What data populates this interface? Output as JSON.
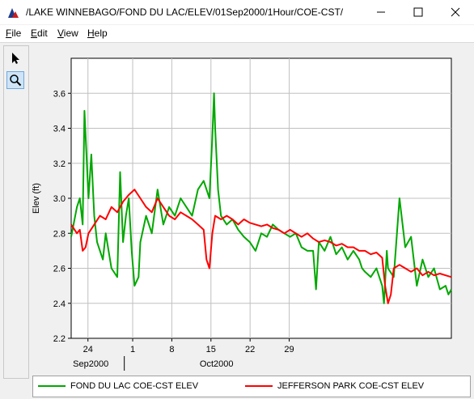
{
  "window": {
    "title": "/LAKE WINNEBAGO/FOND DU LAC/ELEV/01Sep2000/1Hour/COE-CST/"
  },
  "menu": {
    "items": [
      {
        "key": "F",
        "rest": "ile"
      },
      {
        "key": "E",
        "rest": "dit"
      },
      {
        "key": "V",
        "rest": "iew"
      },
      {
        "key": "H",
        "rest": "elp"
      }
    ]
  },
  "toolbar": {
    "tools": [
      {
        "name": "pointer",
        "icon": "arrow-pointer-icon"
      },
      {
        "name": "zoom",
        "icon": "magnifier-icon"
      }
    ]
  },
  "colors": {
    "series1": "#00a800",
    "series2": "#ff0000",
    "grid": "#c0c0c0"
  },
  "chart_data": {
    "type": "line",
    "title": "",
    "ylabel": "Elev (ft)",
    "xlabel": "",
    "ylim": [
      2.2,
      3.8
    ],
    "yticks": [
      "2.2",
      "2.4",
      "2.6",
      "2.8",
      "3.0",
      "3.2",
      "3.4",
      "3.6"
    ],
    "xticks": [
      "24",
      "1",
      "8",
      "15",
      "22",
      "29"
    ],
    "xmonths": [
      "Sep2000",
      "Oct2000"
    ],
    "grid": true,
    "legend_position": "bottom",
    "series": [
      {
        "name": "FOND DU LAC COE-CST ELEV",
        "color": "#00a800",
        "x": [
          22,
          23,
          23.5,
          24,
          24.3,
          25,
          25.5,
          26,
          26.5,
          27,
          27.5,
          28,
          29,
          30,
          30.5,
          31,
          31.5,
          32,
          32.5,
          33,
          33.7,
          34,
          35,
          36,
          37,
          38,
          39,
          40,
          41,
          42,
          43,
          44,
          45,
          46,
          46.5,
          46.8,
          47,
          47.5,
          48,
          49,
          50,
          51,
          52,
          53,
          54,
          55,
          56,
          57,
          58,
          59,
          60,
          61,
          62,
          63,
          64,
          64.5,
          65,
          66,
          67,
          68,
          69,
          70,
          71,
          72,
          72.5,
          73,
          74,
          75,
          76,
          76.3,
          76.8,
          77,
          78,
          79,
          80,
          81,
          82,
          83,
          84,
          85,
          86,
          87,
          87.5,
          88
        ],
        "values": [
          2.78,
          2.95,
          3.0,
          2.85,
          3.5,
          3.0,
          3.25,
          2.9,
          2.75,
          2.7,
          2.65,
          2.8,
          2.6,
          2.55,
          3.15,
          2.75,
          2.9,
          3.0,
          2.7,
          2.5,
          2.55,
          2.75,
          2.9,
          2.8,
          3.05,
          2.85,
          2.95,
          2.9,
          3.0,
          2.95,
          2.9,
          3.05,
          3.1,
          3.0,
          3.35,
          3.6,
          3.4,
          3.05,
          2.9,
          2.85,
          2.88,
          2.82,
          2.78,
          2.75,
          2.7,
          2.8,
          2.78,
          2.85,
          2.82,
          2.8,
          2.78,
          2.8,
          2.72,
          2.7,
          2.7,
          2.48,
          2.75,
          2.7,
          2.78,
          2.68,
          2.72,
          2.65,
          2.7,
          2.65,
          2.6,
          2.58,
          2.55,
          2.6,
          2.5,
          2.4,
          2.7,
          2.6,
          2.55,
          3.0,
          2.72,
          2.78,
          2.5,
          2.65,
          2.55,
          2.6,
          2.48,
          2.5,
          2.45,
          2.48
        ]
      },
      {
        "name": "JEFFERSON PARK COE-CST ELEV",
        "color": "#ff0000",
        "x": [
          22,
          23,
          23.5,
          24,
          24.5,
          25,
          26,
          27,
          28,
          29,
          30,
          31,
          32,
          33,
          34,
          35,
          36,
          37,
          38,
          39,
          40,
          41,
          42,
          43,
          44,
          45,
          45.5,
          46,
          46.5,
          47,
          48,
          49,
          50,
          51,
          52,
          53,
          54,
          55,
          56,
          57,
          58,
          59,
          60,
          61,
          62,
          63,
          64,
          65,
          66,
          67,
          68,
          69,
          70,
          71,
          72,
          73,
          74,
          75,
          76,
          76.5,
          77,
          77.5,
          78,
          79,
          80,
          81,
          82,
          83,
          84,
          85,
          86,
          87,
          88
        ],
        "values": [
          2.85,
          2.8,
          2.82,
          2.7,
          2.72,
          2.8,
          2.85,
          2.9,
          2.88,
          2.95,
          2.92,
          2.98,
          3.02,
          3.05,
          3.0,
          2.95,
          2.92,
          3.0,
          2.95,
          2.9,
          2.88,
          2.92,
          2.9,
          2.88,
          2.85,
          2.82,
          2.65,
          2.6,
          2.8,
          2.9,
          2.88,
          2.9,
          2.88,
          2.85,
          2.88,
          2.86,
          2.85,
          2.84,
          2.85,
          2.83,
          2.82,
          2.8,
          2.82,
          2.8,
          2.78,
          2.8,
          2.77,
          2.75,
          2.76,
          2.75,
          2.73,
          2.74,
          2.72,
          2.72,
          2.7,
          2.7,
          2.68,
          2.69,
          2.66,
          2.5,
          2.4,
          2.45,
          2.6,
          2.62,
          2.6,
          2.58,
          2.6,
          2.56,
          2.58,
          2.56,
          2.57,
          2.56,
          2.55
        ]
      }
    ]
  },
  "legend": {
    "items": [
      {
        "label": "FOND DU LAC COE-CST ELEV",
        "color": "#00a800"
      },
      {
        "label": "JEFFERSON PARK COE-CST ELEV",
        "color": "#ff0000"
      }
    ]
  }
}
